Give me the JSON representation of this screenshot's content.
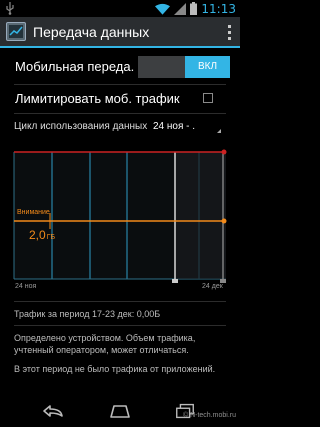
{
  "status_bar": {
    "time": "11:13"
  },
  "action_bar": {
    "title": "Передача данных"
  },
  "settings": {
    "mobile_data": {
      "label": "Мобильная переда.",
      "toggle_state": "ВКЛ"
    },
    "limit_traffic": {
      "label": "Лимитировать моб. трафик",
      "checked": false
    },
    "cycle": {
      "label": "Цикл использования данных",
      "value": "24 ноя - ."
    }
  },
  "chart": {
    "warning_label": "Внимание",
    "warning_value": "2,0",
    "warning_unit": "ГБ",
    "x_start_label": "24 ноя",
    "x_end_label": "24 дек"
  },
  "info": {
    "period": "Трафик за период 17-23 дек: 0,00Б",
    "device_note": "Определено устройством. Объем трафика, учтенный оператором, может отличаться.",
    "no_traffic": "В этот период не было трафика от приложений."
  },
  "watermark": "© N-tech.mobi.ru",
  "colors": {
    "accent": "#33b5e5",
    "warning": "#f28a1a",
    "limit": "#cc2222"
  }
}
